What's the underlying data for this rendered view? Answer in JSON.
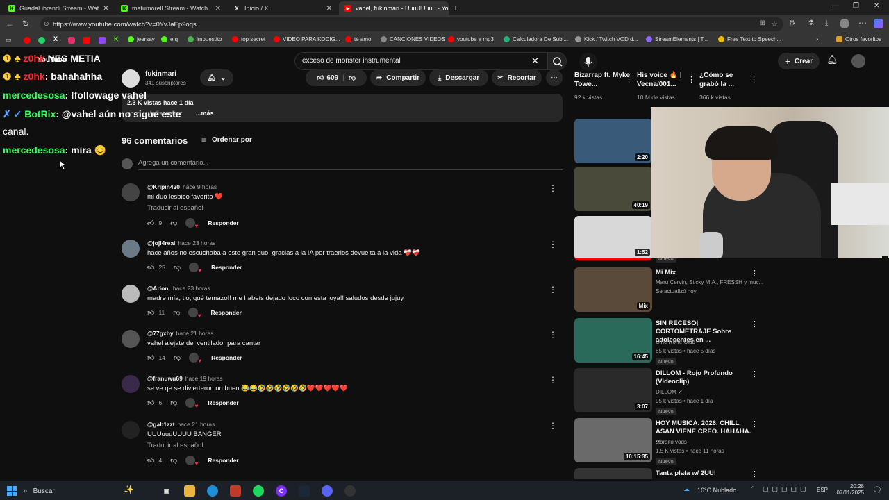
{
  "tabs": [
    {
      "label": "GuadaLibrandi Stream - Wat",
      "favicon_color": "#53fc18",
      "favicon": "K"
    },
    {
      "label": "matumorell Stream - Watch",
      "favicon_color": "#53fc18",
      "favicon": "K"
    },
    {
      "label": "Inicio / X",
      "favicon_color": "#ffffff",
      "favicon": "X"
    },
    {
      "label": "vahel, fukinmari - UuuUUuuu - Yo",
      "favicon_color": "#ff0000",
      "favicon": "▶"
    }
  ],
  "url": "https://www.youtube.com/watch?v=0YvJaEp9oqs",
  "bookmarks": [
    {
      "label": "jeersay",
      "color": "#53fc18"
    },
    {
      "label": "e q",
      "color": "#53fc18"
    },
    {
      "label": "impuestito",
      "color": "#4caf50"
    },
    {
      "label": "top secret",
      "color": "#ff0000"
    },
    {
      "label": "VIDEO PARA KODIG...",
      "color": "#ff0000"
    },
    {
      "label": "te amo",
      "color": "#ff0000"
    },
    {
      "label": "CANCIONES VIDEOS",
      "color": "#888888"
    },
    {
      "label": "youtube a mp3",
      "color": "#ff0000"
    },
    {
      "label": "Calculadora De Subi...",
      "color": "#1fb37a"
    },
    {
      "label": "Kick / Twitch VOD d...",
      "color": "#999999"
    },
    {
      "label": "StreamElements | T...",
      "color": "#8c6cff"
    },
    {
      "label": "Free Text to Speech...",
      "color": "#f0c000"
    }
  ],
  "other_bookmarks": "Otros favoritos",
  "search": {
    "value": "exceso de monster instrumental"
  },
  "header": {
    "create": "Crear",
    "logo": "YouTube"
  },
  "video": {
    "channel": "fukinmari",
    "subscribers": "341 suscriptores",
    "likes": "609",
    "share": "Compartir",
    "download": "Descargar",
    "clip": "Recortar",
    "views": "2.3 K vistas  hace 1 día",
    "more": "...más",
    "desc_partial": "shot: ... / elisanchez"
  },
  "comments_header": {
    "count": "96 comentarios",
    "sort": "Ordenar por",
    "add_placeholder": "Agrega un comentario..."
  },
  "comments": [
    {
      "handle": "@Kripin420",
      "time": "hace 9 horas",
      "text": "mi duo lesbico favorito ❤️",
      "translate": "Traducir al español",
      "likes": "9",
      "reply": "Responder",
      "avatar": "#444"
    },
    {
      "handle": "@joji4real",
      "time": "hace 23 horas",
      "text": "hace años no escuchaba a este gran duo, gracias a la IA por traerlos devuelta a la vida ❤️‍🩹❤️‍🩹",
      "translate": "",
      "likes": "25",
      "reply": "Responder",
      "avatar": "#6b7a87"
    },
    {
      "handle": "@Arion.",
      "time": "hace 23 horas",
      "text": "madre mía, tio, qué temazo!! me habeís dejado loco con esta joya!! saludos desde jujuy",
      "translate": "",
      "likes": "11",
      "reply": "Responder",
      "avatar": "#bbbbbb"
    },
    {
      "handle": "@77gxby",
      "time": "hace 21 horas",
      "text": "vahel alejate del ventilador para cantar",
      "translate": "",
      "likes": "14",
      "reply": "Responder",
      "avatar": "#555"
    },
    {
      "handle": "@franuwu69",
      "time": "hace 19 horas",
      "text": "se ve qe se divierteron un buen 😂😂🤣🤣🤣🤣🤣🤣❤️❤️❤️❤️❤️",
      "translate": "",
      "likes": "6",
      "reply": "Responder",
      "avatar": "#3a2a4a"
    },
    {
      "handle": "@gab1zzt",
      "time": "hace 21 horas",
      "text": "UUUuuuUUUU BANGER",
      "translate": "Traducir al español",
      "likes": "4",
      "reply": "Responder",
      "avatar": "#222"
    }
  ],
  "chat": [
    {
      "user": "z0hk",
      "msg": ": bahahahha",
      "color": "#ff2a2a"
    },
    {
      "user": "mercedesosa",
      "msg": ": !followage vahel",
      "color": "#32ff5a"
    },
    {
      "user": "BotRix",
      "msg": ": @vahel aún no sigue este",
      "color": "#32ff5a"
    },
    {
      "user": "",
      "msg": "canal.",
      "color": "#ffffff"
    },
    {
      "user": "mercedesosa",
      "msg": ": mira 😊",
      "color": "#32ff5a"
    }
  ],
  "chat_top": "NES METIA",
  "recommendations_top": [
    {
      "title": "Bizarrap ft. Myke Towe...",
      "meta": "92 k vistas"
    },
    {
      "title": "His voice 🔥 | Vecna/001...",
      "meta": "10 M de vistas"
    },
    {
      "title": "¿Cómo se grabó la ...",
      "meta": "366 k vistas"
    }
  ],
  "recommendations": [
    {
      "title": "",
      "duration": "2:20",
      "channel": "",
      "meta": "",
      "badge": "",
      "thumb": "#3a5a7a"
    },
    {
      "title": "",
      "duration": "40:19",
      "channel": "",
      "meta": "",
      "badge": "",
      "thumb": "#4a4a3a"
    },
    {
      "title": "",
      "duration": "1:52",
      "channel": "",
      "meta": "",
      "badge": "Nuevo",
      "thumb": "#d8d8d8"
    },
    {
      "title": "Mi Mix",
      "duration": "Mix",
      "channel": "Maru Cervin, Sticky M.A., FRESSH y muc...",
      "meta": "Se actualizó hoy",
      "badge": "",
      "thumb": "#5a4a3a"
    },
    {
      "title": "SIN RECESO| CORTOMETRAJE Sobre adolecentes en ...",
      "duration": "16:45",
      "channel": "Cine Norte Club",
      "meta": "85 k vistas • hace 5 días",
      "badge": "Nuevo",
      "thumb": "#2a6a5a"
    },
    {
      "title": "DILLOM - Rojo Profundo (Videoclip)",
      "duration": "3:07",
      "channel": "DILLOM ✔",
      "meta": "95 k vistas • hace 1 día",
      "badge": "Nuevo",
      "thumb": "#2a2a2a"
    },
    {
      "title": "HOY MUSICA. 2026. CHILL. ASAN VIENE CREO. HAHAHA. ...",
      "duration": "10:15:35",
      "channel": "starsito vods",
      "meta": "1.5 K vistas • hace 11 horas",
      "badge": "Nuevo",
      "thumb": "#6a6a6a"
    },
    {
      "title": "Tanta plata w/ 2UU!",
      "duration": "",
      "channel": "",
      "meta": "",
      "badge": "",
      "thumb": "#333"
    }
  ],
  "taskbar": {
    "search": "Buscar",
    "weather": "16°C  Nublado",
    "lang": "ESP",
    "time": "20:28",
    "date": "07/11/2025"
  }
}
